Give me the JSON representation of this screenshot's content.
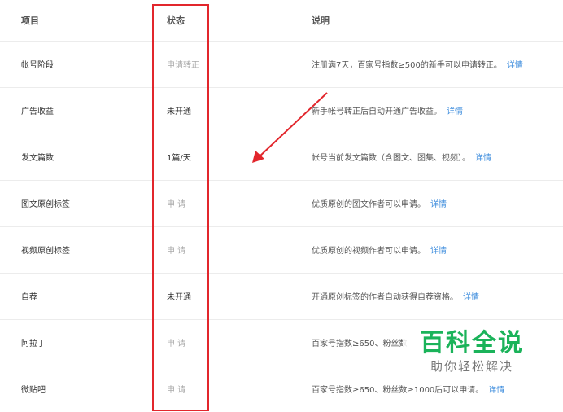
{
  "header": {
    "col_item": "项目",
    "col_status": "状态",
    "col_desc": "说明"
  },
  "rows": [
    {
      "item": "帐号阶段",
      "status": "申请转正",
      "desc": "注册满7天，百家号指数≥500的新手可以申请转正。",
      "link": "详情"
    },
    {
      "item": "广告收益",
      "status": "未开通",
      "desc": "新手帐号转正后自动开通广告收益。",
      "link": "详情"
    },
    {
      "item": "发文篇数",
      "status": "1篇/天",
      "desc": "帐号当前发文篇数（含图文、图集、视频）。",
      "link": "详情"
    },
    {
      "item": "图文原创标签",
      "status": "申 请",
      "desc": "优质原创的图文作者可以申请。",
      "link": "详情"
    },
    {
      "item": "视频原创标签",
      "status": "申 请",
      "desc": "优质原创的视频作者可以申请。",
      "link": "详情"
    },
    {
      "item": "自荐",
      "status": "未开通",
      "desc": "开通原创标签的作者自动获得自荐资格。",
      "link": "详情"
    },
    {
      "item": "阿拉丁",
      "status": "申 请",
      "desc": "百家号指数≥650、粉丝数",
      "link": ""
    },
    {
      "item": "微贴吧",
      "status": "申 请",
      "desc": "百家号指数≥650、粉丝数≥1000后可以申请。",
      "link": "详情"
    }
  ],
  "watermark": {
    "title": "百科全说",
    "subtitle": "助你轻松解决"
  },
  "colors": {
    "highlight_red": "#e2262c",
    "link_blue": "#3e8ddd",
    "watermark_green": "#1bb35a"
  }
}
